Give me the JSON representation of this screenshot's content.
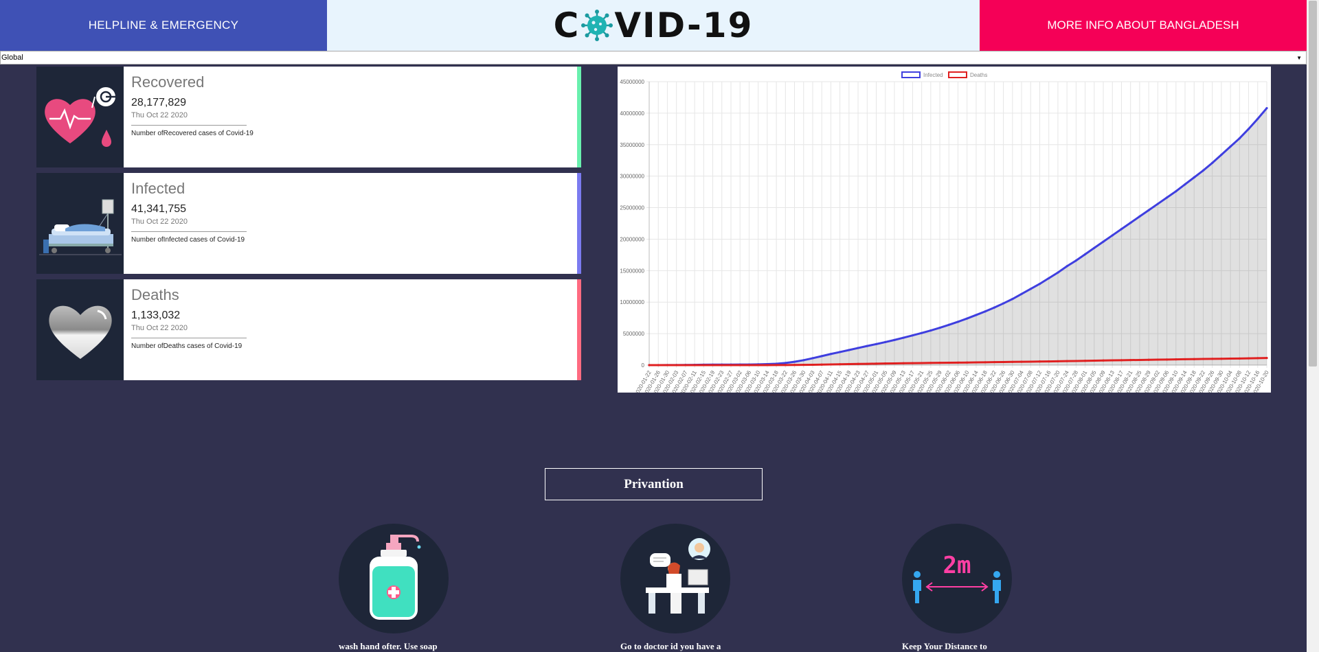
{
  "header": {
    "helpline_label": "HELPLINE & EMERGENCY",
    "logo_left": "C",
    "logo_right": "VID-19",
    "more_info_label": "MORE INFO ABOUT BANGLADESH"
  },
  "region_select": {
    "value": "Global"
  },
  "cards": [
    {
      "title": "Recovered",
      "count": "28,177,829",
      "date": "Thu Oct 22 2020",
      "description": "Number ofRecovered cases of Covid-19",
      "accent": "#69f0ae"
    },
    {
      "title": "Infected",
      "count": "41,341,755",
      "date": "Thu Oct 22 2020",
      "description": "Number ofInfected cases of Covid-19",
      "accent": "#7b7bf0"
    },
    {
      "title": "Deaths",
      "count": "1,133,032",
      "date": "Thu Oct 22 2020",
      "description": "Number ofDeaths cases of Covid-19",
      "accent": "#ff6b81"
    }
  ],
  "chart_data": {
    "type": "line",
    "x_tick_labels": [
      "2020-01-22",
      "2020-01-26",
      "2020-01-30",
      "2020-02-03",
      "2020-02-07",
      "2020-02-11",
      "2020-02-15",
      "2020-02-19",
      "2020-02-23",
      "2020-02-27",
      "2020-03-02",
      "2020-03-06",
      "2020-03-10",
      "2020-03-14",
      "2020-03-18",
      "2020-03-22",
      "2020-03-26",
      "2020-03-30",
      "2020-04-03",
      "2020-04-07",
      "2020-04-11",
      "2020-04-15",
      "2020-04-19",
      "2020-04-23",
      "2020-04-27",
      "2020-05-01",
      "2020-05-05",
      "2020-05-09",
      "2020-05-13",
      "2020-05-17",
      "2020-05-21",
      "2020-05-25",
      "2020-05-29",
      "2020-06-02",
      "2020-06-06",
      "2020-06-10",
      "2020-06-14",
      "2020-06-18",
      "2020-06-22",
      "2020-06-26",
      "2020-06-30",
      "2020-07-04",
      "2020-07-08",
      "2020-07-12",
      "2020-07-16",
      "2020-07-20",
      "2020-07-24",
      "2020-07-28",
      "2020-08-01",
      "2020-08-05",
      "2020-08-09",
      "2020-08-13",
      "2020-08-17",
      "2020-08-21",
      "2020-08-25",
      "2020-08-29",
      "2020-09-02",
      "2020-09-06",
      "2020-09-10",
      "2020-09-14",
      "2020-09-18",
      "2020-09-22",
      "2020-09-26",
      "2020-09-30",
      "2020-10-04",
      "2020-10-08",
      "2020-10-12",
      "2020-10-16",
      "2020-10-20"
    ],
    "series": [
      {
        "name": "Infected",
        "color": "#3f3fdf",
        "fill": true,
        "values": [
          555,
          2000,
          8000,
          17000,
          31000,
          43000,
          67000,
          75000,
          79000,
          83000,
          90000,
          102000,
          119000,
          157000,
          220000,
          337000,
          530000,
          782000,
          1100000,
          1430000,
          1770000,
          2080000,
          2400000,
          2720000,
          3040000,
          3340000,
          3660000,
          3990000,
          4350000,
          4720000,
          5100000,
          5500000,
          5930000,
          6400000,
          6880000,
          7400000,
          7960000,
          8530000,
          9140000,
          9800000,
          10500000,
          11300000,
          12100000,
          12900000,
          13800000,
          14700000,
          15700000,
          16600000,
          17600000,
          18600000,
          19600000,
          20600000,
          21600000,
          22600000,
          23600000,
          24600000,
          25600000,
          26600000,
          27600000,
          28700000,
          29800000,
          30900000,
          32100000,
          33400000,
          34700000,
          36000000,
          37500000,
          39100000,
          40800000
        ]
      },
      {
        "name": "Deaths",
        "color": "#e02020",
        "fill": false,
        "values": [
          17,
          56,
          170,
          362,
          636,
          1018,
          1527,
          2122,
          2469,
          2805,
          3123,
          3460,
          4262,
          5819,
          8780,
          14600,
          24100,
          38000,
          58000,
          81000,
          106000,
          133000,
          166000,
          190000,
          211000,
          234000,
          258000,
          279000,
          298000,
          316000,
          333000,
          348000,
          364000,
          381000,
          398000,
          414000,
          431000,
          450000,
          471000,
          490000,
          513000,
          531000,
          550000,
          570000,
          591000,
          610000,
          634000,
          660000,
          683000,
          708000,
          732000,
          756000,
          778000,
          799000,
          823000,
          846000,
          868000,
          889000,
          913000,
          935000,
          957000,
          977000,
          994000,
          1011000,
          1034000,
          1054000,
          1082000,
          1109000,
          1133000
        ]
      }
    ],
    "ylim": [
      0,
      45000000
    ],
    "y_ticks": [
      0,
      5000000,
      10000000,
      15000000,
      20000000,
      25000000,
      30000000,
      35000000,
      40000000,
      45000000
    ],
    "legend": "top-center",
    "grid": true
  },
  "prevention": {
    "title": "Privantion",
    "items": [
      {
        "text": "wash hand ofter. Use soap and water or an alcohol-"
      },
      {
        "text": "Go to doctor id you have a fever, cough or feel that it is"
      },
      {
        "text": "Keep Your Distance to Slow the Spread",
        "badge": "2m"
      }
    ]
  }
}
